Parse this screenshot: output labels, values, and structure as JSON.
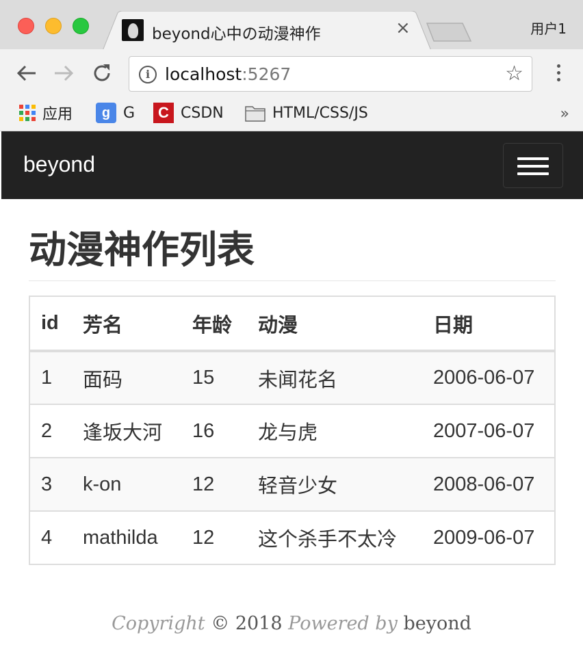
{
  "browser": {
    "tab_title": "beyond心中の动漫神作",
    "tab_close": "×",
    "profile_name": "用户1",
    "url_host": "localhost",
    "url_port": ":5267",
    "bookmarks": [
      {
        "label": "应用",
        "icon": "apps-grid-icon"
      },
      {
        "label": "G",
        "icon": "google-icon"
      },
      {
        "label": "CSDN",
        "icon": "csdn-icon"
      },
      {
        "label": "HTML/CSS/JS",
        "icon": "folder-icon"
      }
    ],
    "more_bookmarks": "»"
  },
  "navbar": {
    "brand": "beyond"
  },
  "main": {
    "heading": "动漫神作列表",
    "table": {
      "headers": [
        "id",
        "芳名",
        "年龄",
        "动漫",
        "日期"
      ],
      "rows": [
        [
          "1",
          "面码",
          "15",
          "未闻花名",
          "2006-06-07"
        ],
        [
          "2",
          "逢坂大河",
          "16",
          "龙与虎",
          "2007-06-07"
        ],
        [
          "3",
          "k-on",
          "12",
          "轻音少女",
          "2008-06-07"
        ],
        [
          "4",
          "mathilda",
          "12",
          "这个杀手不太冷",
          "2009-06-07"
        ]
      ]
    }
  },
  "footer": {
    "copyright_word": "Copyright",
    "symbol_year": "© 2018",
    "powered_by": "Powered by",
    "author": "beyond"
  },
  "colors": {
    "navbar_bg": "#222222",
    "table_border": "#dddddd",
    "stripe": "#f9f9f9"
  }
}
